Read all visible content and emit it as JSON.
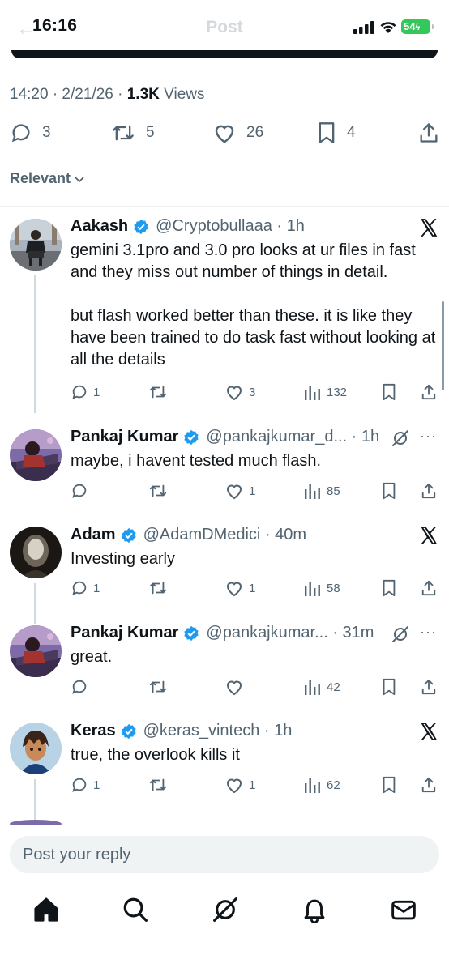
{
  "status_bar": {
    "time": "16:16",
    "battery": "54",
    "ghost_title": "Post",
    "icons": [
      "cellular-icon",
      "wifi-icon",
      "battery-icon"
    ]
  },
  "post": {
    "timestamp": "14:20 · 2/21/26 · ",
    "views_count": "1.3K",
    "views_label": " Views",
    "actions": {
      "replies": "3",
      "reposts": "5",
      "likes": "26",
      "bookmarks": "4"
    }
  },
  "sort": {
    "label": "Relevant"
  },
  "replies": [
    {
      "name": "Aakash",
      "handle": "@Cryptobullaaa · 1h",
      "text": "gemini 3.1pro and 3.0 pro looks at ur files in fast and they miss out number of things in detail.\n\nbut flash worked better than these. it is like they have been trained to do task fast without looking at all the details",
      "replies": "1",
      "reposts": "",
      "likes": "3",
      "views": "132"
    },
    {
      "name": "Pankaj Kumar",
      "handle": "@pankajkumar_d... · 1h",
      "text": "maybe, i havent tested much flash.",
      "replies": "",
      "reposts": "",
      "likes": "1",
      "views": "85"
    },
    {
      "name": "Adam",
      "handle": "@AdamDMedici · 40m",
      "text": "Investing early",
      "replies": "1",
      "reposts": "",
      "likes": "1",
      "views": "58"
    },
    {
      "name": "Pankaj Kumar",
      "handle": "@pankajkumar... · 31m",
      "text": "great.",
      "replies": "",
      "reposts": "",
      "likes": "",
      "views": "42"
    },
    {
      "name": "Keras",
      "handle": "@keras_vintech · 1h",
      "text": "true, the overlook kills it",
      "replies": "1",
      "reposts": "",
      "likes": "1",
      "views": "62"
    }
  ],
  "reply_input": {
    "placeholder": "Post your reply"
  },
  "tabs": [
    "home-icon",
    "search-icon",
    "grok-icon",
    "notifications-icon",
    "messages-icon"
  ],
  "colors": {
    "verified": "#1d9bf0",
    "text": "#0f1419",
    "secondary": "#536471",
    "battery": "#34c759"
  }
}
